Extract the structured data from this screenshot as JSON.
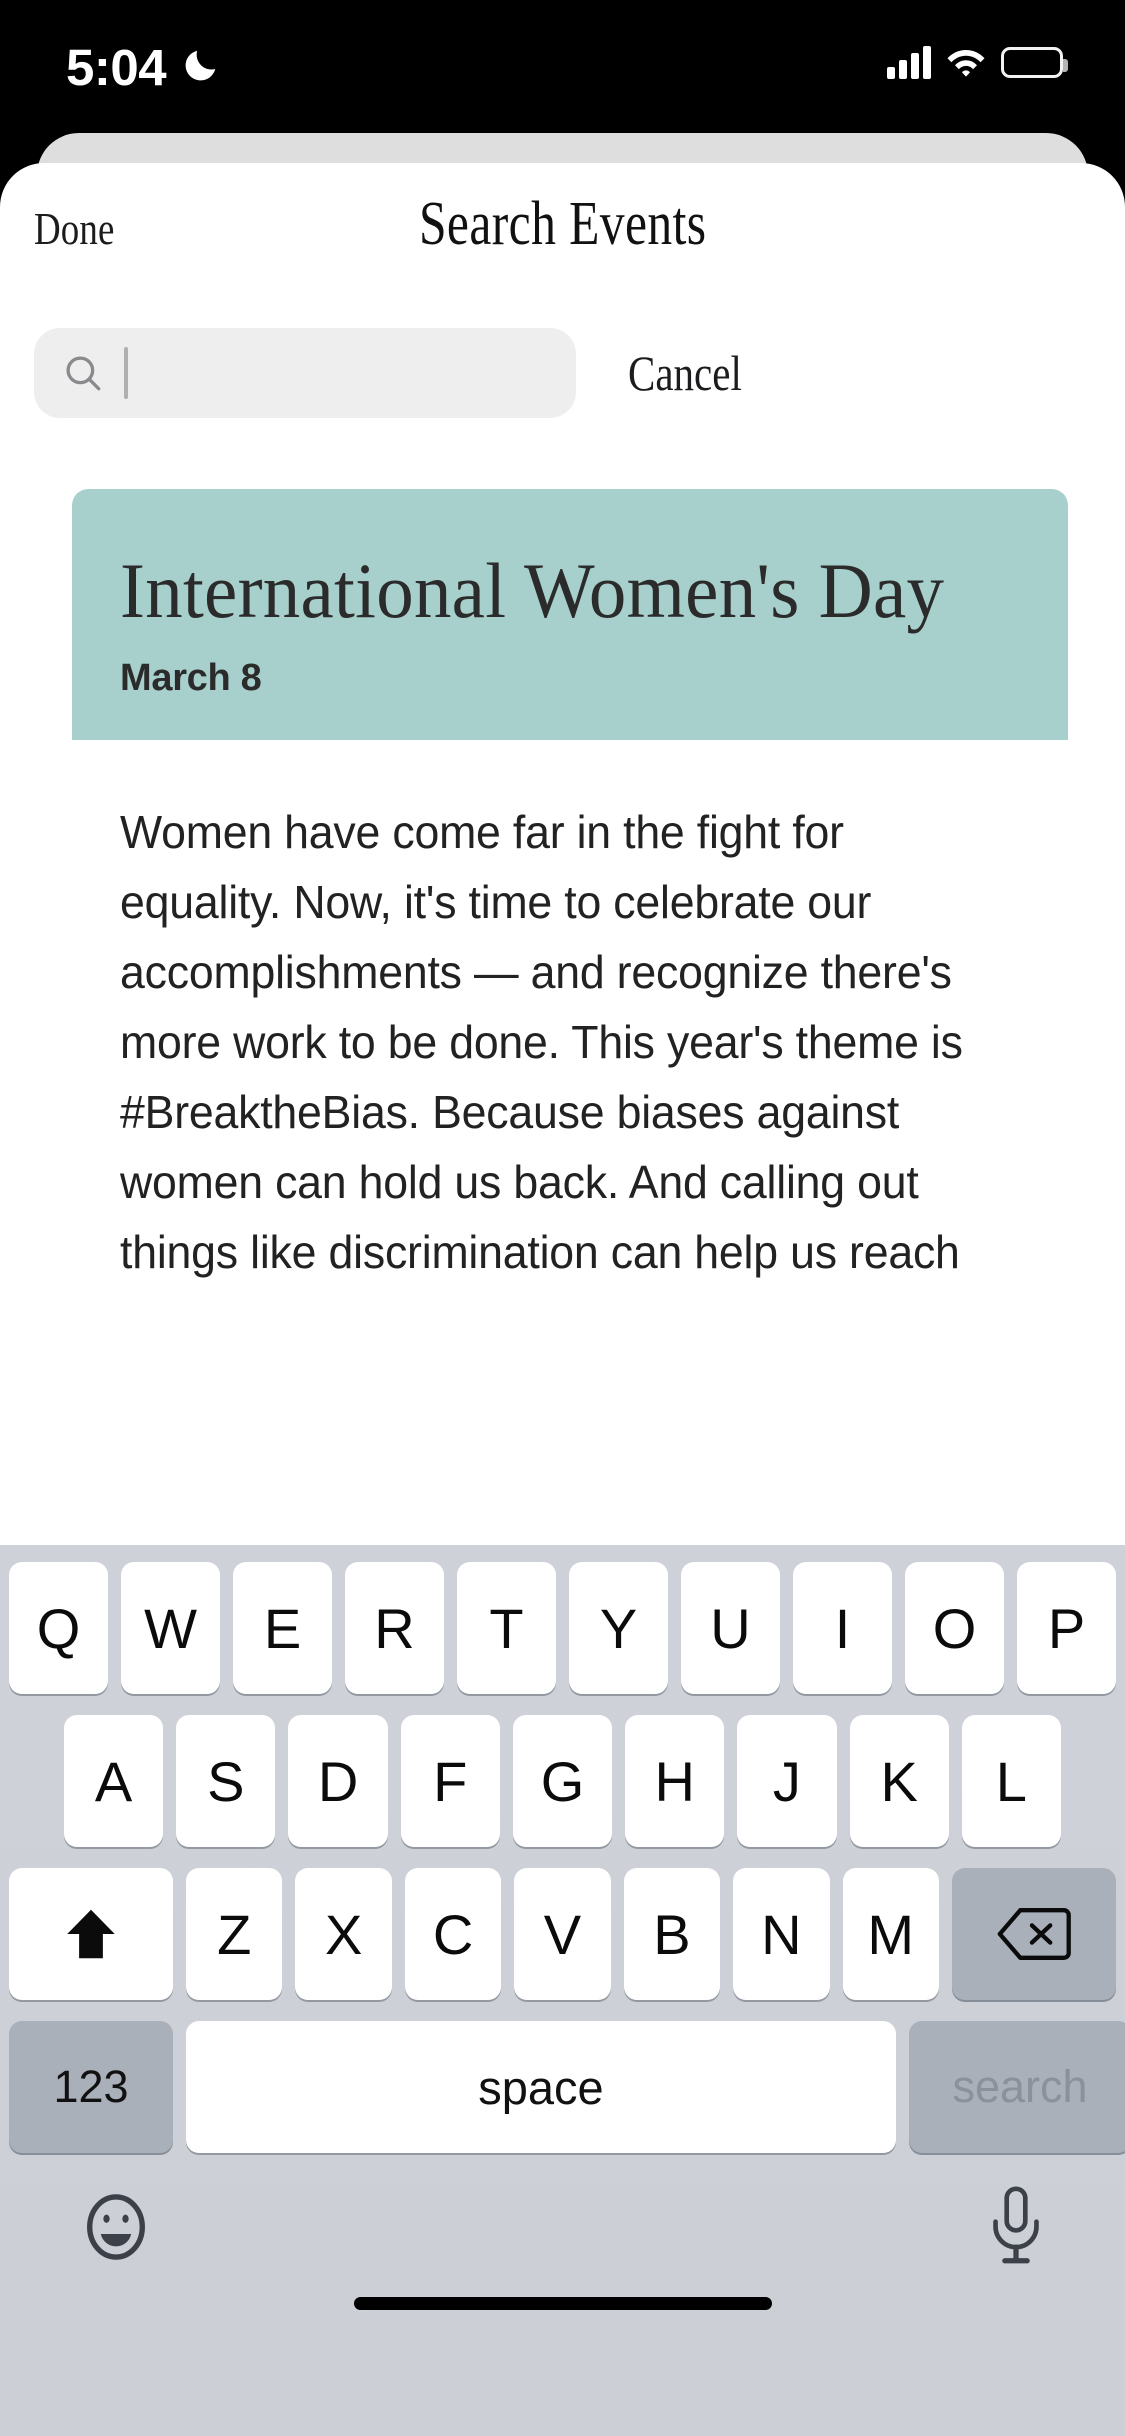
{
  "status_bar": {
    "time": "5:04",
    "dnd_icon": "moon-crescent-icon",
    "cellular_icon": "signal-bars-icon",
    "wifi_icon": "wifi-icon",
    "battery_icon": "battery-full-icon"
  },
  "nav": {
    "done_label": "Done",
    "title": "Search Events"
  },
  "search": {
    "icon": "search-icon",
    "value": "",
    "placeholder": "",
    "cancel_label": "Cancel"
  },
  "event_card": {
    "title": "International Women's Day",
    "date": "March 8",
    "accent_color": "#a7d0cc",
    "body": "Women have come far in the fight for equality. Now, it's time to celebrate our accomplishments — and recognize there's more work to be done. This year's theme is #BreaktheBias. Because biases against women can hold us back. And calling out things like discrimination can help us reach"
  },
  "keyboard": {
    "row1": [
      "Q",
      "W",
      "E",
      "R",
      "T",
      "Y",
      "U",
      "I",
      "O",
      "P"
    ],
    "row2": [
      "A",
      "S",
      "D",
      "F",
      "G",
      "H",
      "J",
      "K",
      "L"
    ],
    "row3": [
      "Z",
      "X",
      "C",
      "V",
      "B",
      "N",
      "M"
    ],
    "shift_icon": "shift-arrow-up-icon",
    "backspace_icon": "backspace-delete-icon",
    "numbers_label": "123",
    "space_label": "space",
    "return_label": "search",
    "emoji_icon": "emoji-smiley-icon",
    "dictation_icon": "microphone-icon"
  },
  "home_indicator": "home-indicator-bar"
}
